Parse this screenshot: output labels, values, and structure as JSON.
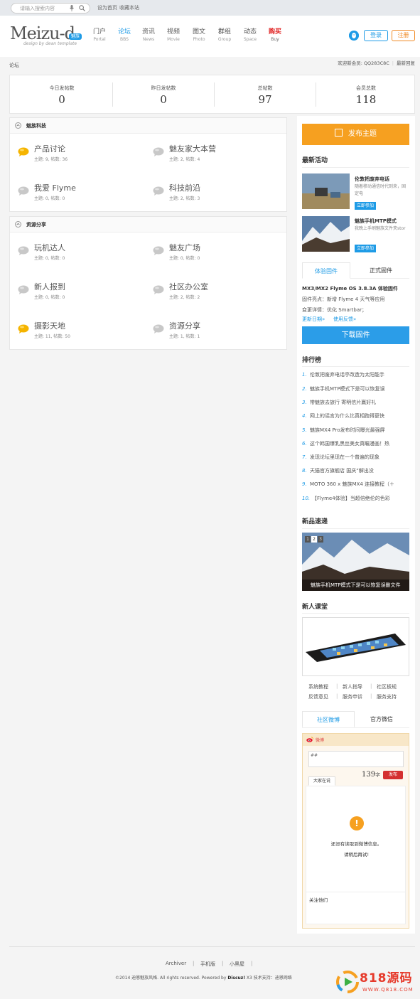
{
  "topbar": {
    "search_placeholder": "请输入搜索内容",
    "set_home": "设为首页",
    "bookmark": "收藏本站"
  },
  "brand": {
    "logo": "Meizu-d",
    "badge": "魅族",
    "tagline": "design by dean template"
  },
  "nav": [
    {
      "cn": "门户",
      "en": "Portal"
    },
    {
      "cn": "论坛",
      "en": "BBS"
    },
    {
      "cn": "资讯",
      "en": "News"
    },
    {
      "cn": "视频",
      "en": "Movie"
    },
    {
      "cn": "图文",
      "en": "Photo"
    },
    {
      "cn": "群组",
      "en": "Group"
    },
    {
      "cn": "动态",
      "en": "Space"
    },
    {
      "cn": "购买",
      "en": "Buy"
    }
  ],
  "auth": {
    "login": "登录",
    "register": "注册"
  },
  "breadcrumb": "论坛",
  "welcome": {
    "text": "欢迎新会员: QQ283C8C",
    "latest": "最新回复"
  },
  "stats": [
    {
      "label": "今日发帖数",
      "value": "0"
    },
    {
      "label": "昨日发帖数",
      "value": "0"
    },
    {
      "label": "总帖数",
      "value": "97"
    },
    {
      "label": "会员总数",
      "value": "118"
    }
  ],
  "groups": [
    {
      "title": "魅族科技",
      "forums": [
        {
          "name": "产品讨论",
          "meta": "主题: 9, 帖数: 36"
        },
        {
          "name": "魅友家大本营",
          "meta": "主题: 2, 帖数: 4"
        },
        {
          "name": "我爱 Flyme",
          "meta": "主题: 0, 帖数: 0"
        },
        {
          "name": "科技前沿",
          "meta": "主题: 2, 帖数: 3"
        }
      ]
    },
    {
      "title": "资源分享",
      "forums": [
        {
          "name": "玩机达人",
          "meta": "主题: 0, 帖数: 0"
        },
        {
          "name": "魅友广场",
          "meta": "主题: 0, 帖数: 0"
        },
        {
          "name": "新人报到",
          "meta": "主题: 0, 帖数: 0"
        },
        {
          "name": "社区办公室",
          "meta": "主题: 2, 帖数: 2"
        },
        {
          "name": "摄影天地",
          "meta": "主题: 11, 帖数: 50"
        },
        {
          "name": "资源分享",
          "meta": "主题: 1, 帖数: 1"
        }
      ]
    }
  ],
  "sidebar": {
    "publish": "发布主题",
    "latest_title": "最新活动",
    "events": [
      {
        "title": "伦敦把废弃电话",
        "desc": "随着移动通信时代到来，固定电",
        "join": "立即参加"
      },
      {
        "title": "魅族手机MTP模式",
        "desc": "我晚上手刷魅族文件夹stor",
        "join": "立即参加"
      }
    ],
    "firmware_tabs": [
      "体验固件",
      "正式固件"
    ],
    "firmware": {
      "title": "MX3/MX2 Flyme OS 3.8.3A 体验固件",
      "line1": "固件亮点：新增 Flyme 4 天气等应用",
      "line2": "变更详情：优化 Smartbar；",
      "link1": "更新日期»",
      "link2": "使用反馈»",
      "download": "下载固件"
    },
    "rank_title": "排行榜",
    "rank": [
      "伦敦把废弃电话亭改造为太阳能手",
      "魅族手机MTP模式下是可以恢复误",
      "带魅族去旅行 寄明信片赢好礼",
      "网上的谣言为什么比真相跑得更快",
      "魅族MX4 Pro发布时间曝光最强屏",
      "这个韩国爆乳黑丝美女真瞩漫画！热",
      "发现论坛里现在一个普遍的现象",
      "天猫官方旗舰店 国庆“解出没",
      "MOTO 360 x 魅族MX4 连接教程（＋",
      "【Flyme4体验】当超倍绝伦的色彩"
    ],
    "newprod_title": "新品速递",
    "newprod_pages": [
      "1",
      "2",
      "3"
    ],
    "newprod_caption": "魅族手机MTP模式下是可以恢复误删文件",
    "newbie_title": "新人课堂",
    "newbie_links": [
      "系统教程",
      "新人指导",
      "社区板规",
      "反馈意见",
      "服务申诉",
      "服务支持"
    ],
    "weibo_tabs": [
      "社区微博",
      "官方微信"
    ],
    "weibo": {
      "label": "微博",
      "input": "##",
      "count": "139",
      "count_unit": "字",
      "send": "发布",
      "tab": "大家在说",
      "msg1": "还没有读取到微博信息。",
      "msg2": "请稍后再试!",
      "follow": "关注他们"
    }
  },
  "footer": {
    "links": [
      "Archiver",
      "手机版",
      "小黑屋"
    ],
    "copyright": "©2014  迪恩魅族风格. All rights reserved.    Powered by",
    "discuz": "Discuz!",
    "copyright2": " X3   技术支持：迪恩网络"
  },
  "watermark": {
    "text": "818源码",
    "url": "WWW.Q818.COM"
  }
}
